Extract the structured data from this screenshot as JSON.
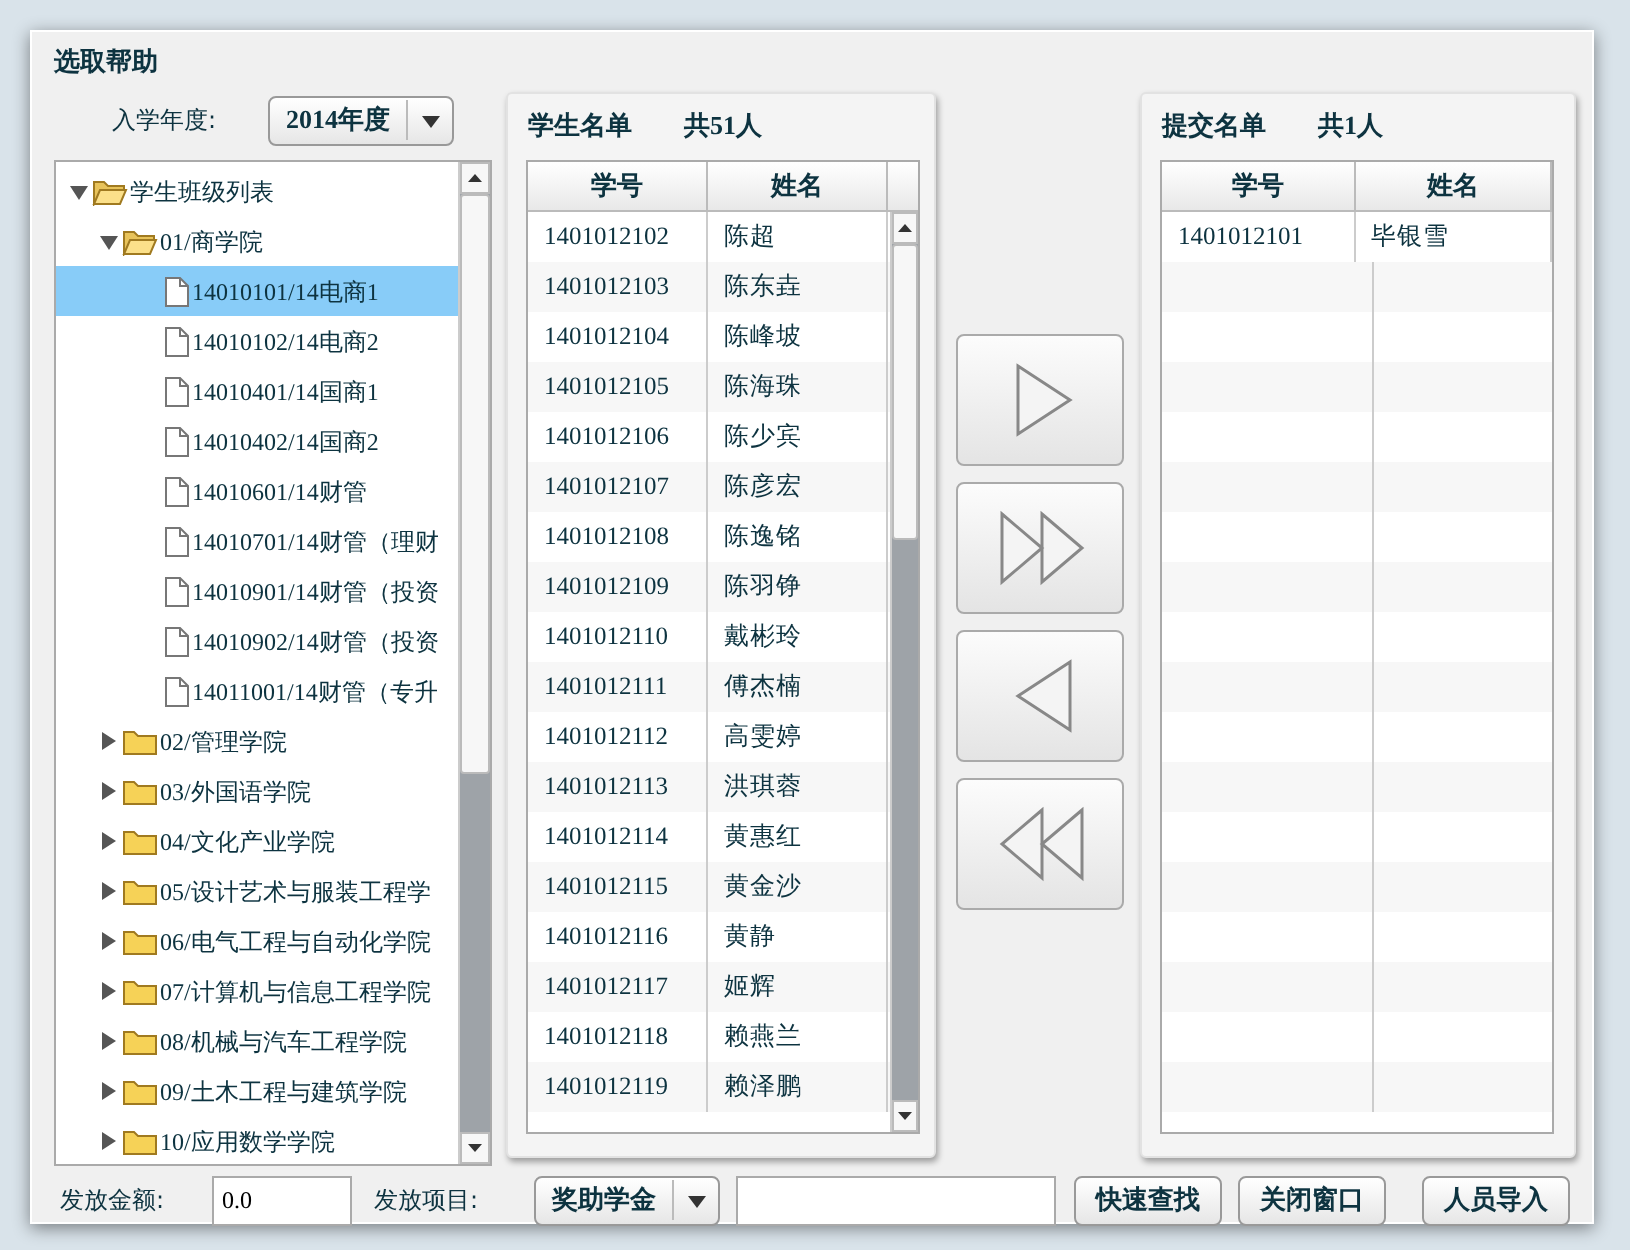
{
  "dialog": {
    "title": "选取帮助"
  },
  "year_filter": {
    "label": "入学年度:",
    "value": "2014年度"
  },
  "tree": {
    "kind": "folder",
    "label": "学生班级列表",
    "expanded": true,
    "selected": false,
    "children": [
      {
        "kind": "folder",
        "label": "01/商学院",
        "expanded": true,
        "selected": false,
        "children": [
          {
            "label": "14010101/14电商1",
            "selected": true
          },
          {
            "label": "14010102/14电商2",
            "selected": false
          },
          {
            "label": "14010401/14国商1",
            "selected": false
          },
          {
            "label": "14010402/14国商2",
            "selected": false
          },
          {
            "label": "14010601/14财管",
            "selected": false
          },
          {
            "label": "14010701/14财管（理财",
            "selected": false
          },
          {
            "label": "14010901/14财管（投资",
            "selected": false
          },
          {
            "label": "14010902/14财管（投资",
            "selected": false
          },
          {
            "label": "14011001/14财管（专升",
            "selected": false
          }
        ]
      },
      {
        "kind": "folder",
        "label": "02/管理学院",
        "expanded": false,
        "selected": false
      },
      {
        "kind": "folder",
        "label": "03/外国语学院",
        "expanded": false,
        "selected": false
      },
      {
        "kind": "folder",
        "label": "04/文化产业学院",
        "expanded": false,
        "selected": false
      },
      {
        "kind": "folder",
        "label": "05/设计艺术与服装工程学",
        "expanded": false,
        "selected": false
      },
      {
        "kind": "folder",
        "label": "06/电气工程与自动化学院",
        "expanded": false,
        "selected": false
      },
      {
        "kind": "folder",
        "label": "07/计算机与信息工程学院",
        "expanded": false,
        "selected": false
      },
      {
        "kind": "folder",
        "label": "08/机械与汽车工程学院",
        "expanded": false,
        "selected": false
      },
      {
        "kind": "folder",
        "label": "09/土木工程与建筑学院",
        "expanded": false,
        "selected": false
      },
      {
        "kind": "folder",
        "label": "10/应用数学学院",
        "expanded": false,
        "selected": false
      }
    ]
  },
  "student_list": {
    "title": "学生名单",
    "count": "共51人",
    "columns": [
      "学号",
      "姓名"
    ],
    "rows": [
      [
        "1401012102",
        "陈超"
      ],
      [
        "1401012103",
        "陈东垚"
      ],
      [
        "1401012104",
        "陈峰坡"
      ],
      [
        "1401012105",
        "陈海珠"
      ],
      [
        "1401012106",
        "陈少宾"
      ],
      [
        "1401012107",
        "陈彦宏"
      ],
      [
        "1401012108",
        "陈逸铭"
      ],
      [
        "1401012109",
        "陈羽铮"
      ],
      [
        "1401012110",
        "戴彬玲"
      ],
      [
        "1401012111",
        "傅杰楠"
      ],
      [
        "1401012112",
        "高雯婷"
      ],
      [
        "1401012113",
        "洪琪蓉"
      ],
      [
        "1401012114",
        "黄惠红"
      ],
      [
        "1401012115",
        "黄金沙"
      ],
      [
        "1401012116",
        "黄静"
      ],
      [
        "1401012117",
        "姬辉"
      ],
      [
        "1401012118",
        "赖燕兰"
      ],
      [
        "1401012119",
        "赖泽鹏"
      ]
    ]
  },
  "transfer_buttons": [
    {
      "kind": "add"
    },
    {
      "kind": "add_all"
    },
    {
      "kind": "remove"
    },
    {
      "kind": "remove_all"
    }
  ],
  "submit_list": {
    "title": "提交名单",
    "count": "共1人",
    "columns": [
      "学号",
      "姓名"
    ],
    "rows": [
      [
        "1401012101",
        "毕银雪"
      ]
    ]
  },
  "footer": {
    "amount_label": "发放金额:",
    "amount_value": "0.0",
    "item_label": "发放项目:",
    "item_value": "奖助学金",
    "buttons": [
      "快速查找",
      "关闭窗口",
      "人员导入"
    ]
  }
}
